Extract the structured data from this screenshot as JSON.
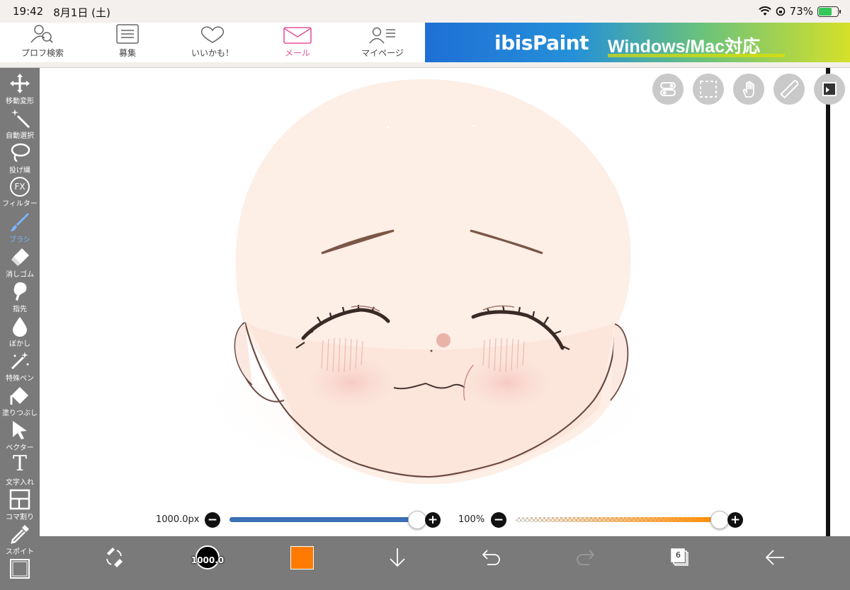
{
  "status": {
    "time": "19:42",
    "date": "8月1日 (土)",
    "battery": "73%",
    "battery_level": 0.73
  },
  "ad_nav": {
    "items": [
      {
        "label": "プロフ検索",
        "icon": "profile-search-icon"
      },
      {
        "label": "募集",
        "icon": "list-icon"
      },
      {
        "label": "いいかも！",
        "icon": "heart-icon"
      },
      {
        "label": "メール",
        "icon": "mail-icon"
      },
      {
        "label": "マイページ",
        "icon": "mypage-icon"
      }
    ],
    "active": "メール"
  },
  "ad_banner": {
    "logo": "ibisPaint",
    "text": "Windows/Mac対応"
  },
  "tools": [
    {
      "label": "移動変形",
      "icon": "move-icon"
    },
    {
      "label": "自動選択",
      "icon": "magic-wand-icon"
    },
    {
      "label": "投げ縄",
      "icon": "lasso-icon"
    },
    {
      "label": "フィルター",
      "icon": "fx-icon",
      "glyph": "FX"
    },
    {
      "label": "ブラシ",
      "icon": "brush-icon"
    },
    {
      "label": "消しゴム",
      "icon": "eraser-icon"
    },
    {
      "label": "指先",
      "icon": "finger-icon"
    },
    {
      "label": "ぼかし",
      "icon": "blur-icon"
    },
    {
      "label": "特殊ペン",
      "icon": "special-pen-icon"
    },
    {
      "label": "塗りつぶし",
      "icon": "fill-icon"
    },
    {
      "label": "ベクター",
      "icon": "vector-icon"
    },
    {
      "label": "文字入れ",
      "icon": "text-icon",
      "glyph": "T"
    },
    {
      "label": "コマ割り",
      "icon": "frame-divider-icon"
    },
    {
      "label": "スポイト",
      "icon": "eyedropper-icon"
    },
    {
      "label": "",
      "icon": "canvas-icon"
    }
  ],
  "active_tool": "ブラシ",
  "top_buttons": [
    "toggle-icon",
    "selection-icon",
    "hand-icon",
    "ruler-icon",
    "layer-view-icon"
  ],
  "size_slider": {
    "label": "1000.0px",
    "fraction": 0.99,
    "color": "#3a6fb5"
  },
  "opacity_slider": {
    "label": "100%",
    "fraction": 1.0,
    "color": "#ff8a00"
  },
  "bottom": {
    "brush_size_label": "1000.0",
    "current_color": "#ff7a00",
    "layer_count": "6"
  }
}
